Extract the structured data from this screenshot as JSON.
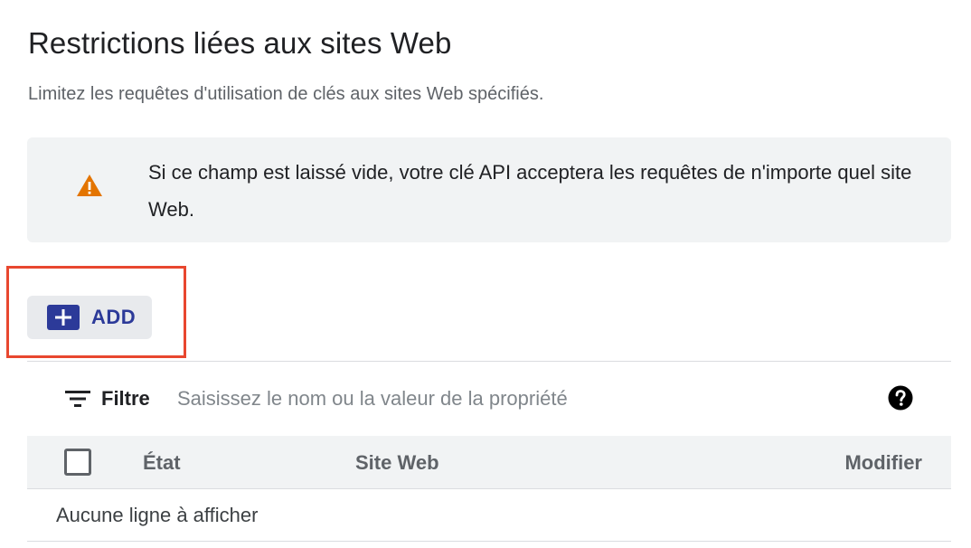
{
  "section": {
    "title": "Restrictions liées aux sites Web",
    "subtitle": "Limitez les requêtes d'utilisation de clés aux sites Web spécifiés."
  },
  "warning": {
    "icon": "warning-triangle-icon",
    "icon_color": "#e37400",
    "text": "Si ce champ est laissé vide, votre clé API acceptera les requêtes de n'importe quel site Web."
  },
  "add_button": {
    "label": "ADD",
    "icon": "plus-icon",
    "accent_color": "#2c3a99"
  },
  "highlight_color": "#e8472f",
  "filter": {
    "label": "Filtre",
    "icon": "filter-list-icon",
    "placeholder": "Saisissez le nom ou la valeur de la propriété",
    "value": "",
    "help_icon": "help-circle-icon"
  },
  "table": {
    "columns": [
      "État",
      "Site Web",
      "Modifier"
    ],
    "select_all_checked": false,
    "rows": [],
    "empty_message": "Aucune ligne à afficher"
  }
}
